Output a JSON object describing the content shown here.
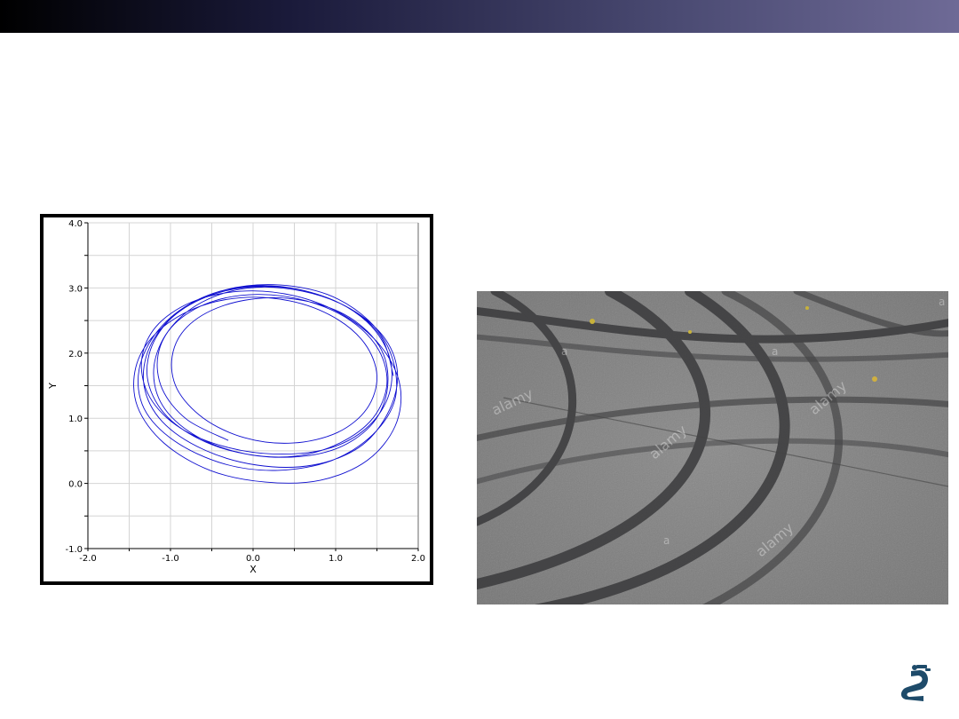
{
  "slide": {
    "header_color_start": "#000000",
    "header_color_end": "#6e6a96"
  },
  "chart_data": {
    "type": "line",
    "title": "",
    "xlabel": "X",
    "ylabel": "Y",
    "xlim": [
      -2.0,
      2.0
    ],
    "ylim": [
      -1.0,
      4.0
    ],
    "x_ticks": [
      "-2.0",
      "-1.0",
      "0.0",
      "1.0",
      "2.0"
    ],
    "y_ticks": [
      "-1.0",
      "0.0",
      "1.0",
      "2.0",
      "3.0",
      "4.0"
    ],
    "grid": true,
    "line_color": "#1010d0",
    "series": [
      {
        "description_free": true,
        "points": [
          [
            1.7,
            1.65
          ],
          [
            1.55,
            2.25
          ],
          [
            1.15,
            2.7
          ],
          [
            0.55,
            2.98
          ],
          [
            -0.1,
            3.02
          ],
          [
            -0.7,
            2.8
          ],
          [
            -1.15,
            2.35
          ],
          [
            -1.38,
            1.75
          ],
          [
            -1.32,
            1.15
          ],
          [
            -0.95,
            0.65
          ],
          [
            -0.35,
            0.3
          ],
          [
            0.3,
            0.2
          ],
          [
            0.95,
            0.35
          ],
          [
            1.45,
            0.75
          ],
          [
            1.72,
            1.3
          ],
          [
            1.68,
            1.95
          ],
          [
            1.4,
            2.5
          ],
          [
            0.9,
            2.9
          ],
          [
            0.25,
            3.05
          ],
          [
            -0.4,
            2.95
          ],
          [
            -0.92,
            2.62
          ],
          [
            -1.25,
            2.1
          ],
          [
            -1.32,
            1.5
          ],
          [
            -1.1,
            0.95
          ],
          [
            -0.6,
            0.52
          ],
          [
            0.05,
            0.28
          ],
          [
            0.72,
            0.28
          ],
          [
            1.28,
            0.55
          ],
          [
            1.62,
            1.05
          ],
          [
            1.75,
            1.65
          ],
          [
            1.6,
            2.22
          ],
          [
            1.18,
            2.68
          ],
          [
            0.6,
            2.95
          ],
          [
            -0.05,
            3.0
          ],
          [
            -0.62,
            2.78
          ],
          [
            -1.02,
            2.35
          ],
          [
            -1.2,
            1.8
          ],
          [
            -1.12,
            1.25
          ],
          [
            -0.78,
            0.8
          ],
          [
            -0.25,
            0.5
          ],
          [
            0.38,
            0.4
          ],
          [
            0.98,
            0.52
          ],
          [
            1.42,
            0.88
          ],
          [
            1.62,
            1.4
          ],
          [
            1.58,
            1.98
          ],
          [
            1.28,
            2.45
          ],
          [
            0.8,
            2.75
          ],
          [
            0.2,
            2.85
          ],
          [
            -0.38,
            2.72
          ],
          [
            -0.8,
            2.4
          ],
          [
            -0.98,
            1.95
          ],
          [
            -0.92,
            1.45
          ],
          [
            -0.6,
            1.0
          ],
          [
            -0.1,
            0.7
          ],
          [
            0.48,
            0.62
          ],
          [
            1.02,
            0.78
          ],
          [
            1.38,
            1.15
          ],
          [
            1.5,
            1.65
          ],
          [
            1.35,
            2.15
          ],
          [
            0.98,
            2.55
          ],
          [
            0.45,
            2.8
          ],
          [
            -0.15,
            2.85
          ],
          [
            -0.72,
            2.68
          ],
          [
            -1.18,
            2.3
          ],
          [
            -1.42,
            1.78
          ],
          [
            -1.4,
            1.18
          ],
          [
            -1.08,
            0.62
          ],
          [
            -0.52,
            0.2
          ],
          [
            0.15,
            0.02
          ],
          [
            0.82,
            0.05
          ],
          [
            1.38,
            0.35
          ],
          [
            1.72,
            0.88
          ],
          [
            1.78,
            1.5
          ],
          [
            1.55,
            2.1
          ],
          [
            1.1,
            2.58
          ],
          [
            0.5,
            2.88
          ],
          [
            -0.15,
            2.95
          ],
          [
            -0.75,
            2.78
          ],
          [
            -1.18,
            2.4
          ],
          [
            -1.35,
            1.88
          ],
          [
            -1.25,
            1.32
          ],
          [
            -0.88,
            0.85
          ],
          [
            -0.3,
            0.55
          ],
          [
            0.35,
            0.45
          ],
          [
            0.95,
            0.55
          ],
          [
            1.4,
            0.88
          ],
          [
            1.65,
            1.38
          ],
          [
            1.65,
            1.95
          ],
          [
            1.38,
            2.48
          ],
          [
            0.9,
            2.85
          ],
          [
            0.28,
            3.02
          ],
          [
            -0.35,
            2.95
          ],
          [
            -0.88,
            2.65
          ],
          [
            -1.2,
            2.18
          ],
          [
            -1.28,
            1.62
          ],
          [
            -1.08,
            1.08
          ],
          [
            -0.65,
            0.68
          ],
          [
            -0.08,
            0.45
          ],
          [
            0.52,
            0.42
          ],
          [
            1.05,
            0.62
          ],
          [
            1.45,
            1.0
          ],
          [
            1.62,
            1.52
          ],
          [
            1.52,
            2.05
          ],
          [
            1.18,
            2.5
          ],
          [
            0.65,
            2.8
          ],
          [
            0.05,
            2.9
          ],
          [
            -0.52,
            2.78
          ],
          [
            -0.95,
            2.45
          ],
          [
            -1.15,
            1.98
          ],
          [
            -1.1,
            1.45
          ],
          [
            -0.8,
            0.98
          ],
          [
            -0.3,
            0.66
          ]
        ]
      }
    ]
  },
  "photo": {
    "watermarks": [
      "a",
      "alamy",
      "a",
      "alamy",
      "a",
      "alamy",
      "a"
    ]
  },
  "logo": {
    "icon": "robot-arm-icon"
  }
}
